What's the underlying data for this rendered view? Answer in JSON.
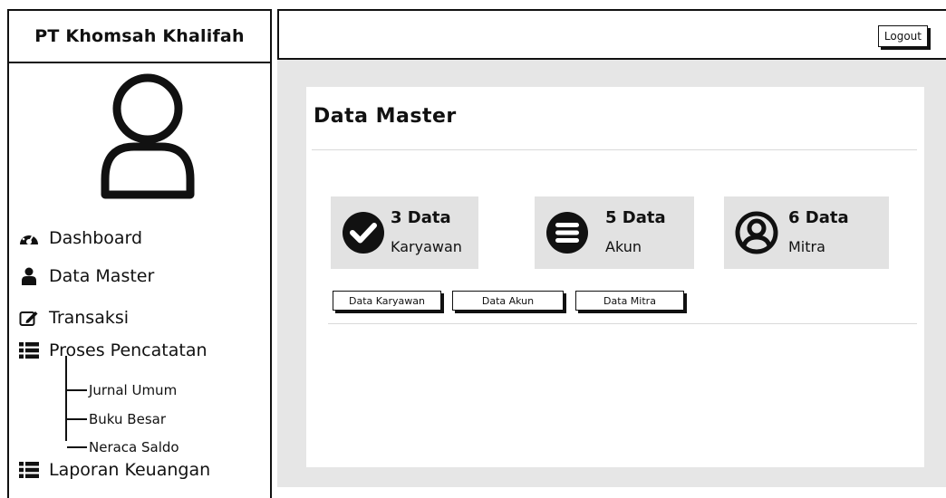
{
  "sidebar": {
    "brand": "PT Khomsah Khalifah",
    "avatar_icon": "user-outline-icon",
    "items": [
      {
        "label": "Dashboard",
        "icon": "dashboard-icon"
      },
      {
        "label": "Data Master",
        "icon": "user-icon"
      },
      {
        "label": "Transaksi",
        "icon": "edit-icon"
      },
      {
        "label": "Proses Pencatatan",
        "icon": "list-icon"
      },
      {
        "label": "Laporan Keuangan",
        "icon": "list-icon"
      }
    ],
    "subitems": [
      "Jurnal Umum",
      "Buku Besar",
      "Neraca Saldo"
    ]
  },
  "header": {
    "logout_label": "Logout"
  },
  "main": {
    "title": "Data Master",
    "cards": [
      {
        "count": "3 Data",
        "label": "Karyawan",
        "icon": "check-circle-icon"
      },
      {
        "count": "5 Data",
        "label": "Akun",
        "icon": "menu-circle-icon"
      },
      {
        "count": "6 Data",
        "label": "Mitra",
        "icon": "user-circle-icon"
      }
    ],
    "buttons": [
      "Data Karyawan",
      "Data Akun",
      "Data Mitra"
    ]
  },
  "colors": {
    "card_bg": "#e2e2e2",
    "content_bg": "#e6e6e6",
    "border": "#111111"
  }
}
